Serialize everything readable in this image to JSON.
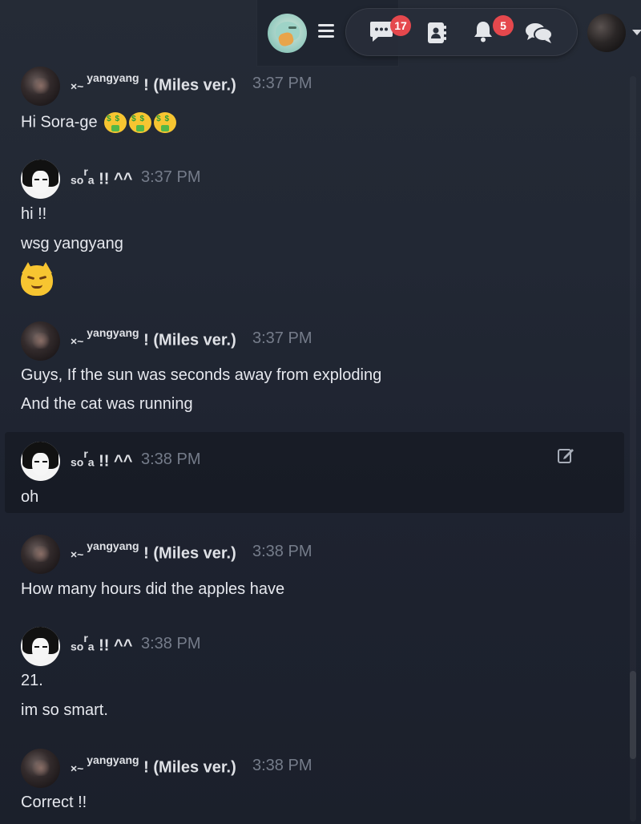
{
  "topbar": {
    "logo_icon": "app-logo",
    "menu_icon": "hamburger-menu-icon",
    "nav": [
      {
        "icon": "chat-bubble-icon",
        "badge": "17"
      },
      {
        "icon": "contacts-book-icon",
        "badge": ""
      },
      {
        "icon": "bell-icon",
        "badge": "5"
      },
      {
        "icon": "conversations-icon",
        "badge": ""
      }
    ],
    "badge_color": "#e5484d",
    "profile_caret_icon": "caret-down-icon"
  },
  "users": {
    "yangyang": {
      "prefix": "×~ ",
      "sup": "yangyang",
      "suffix": " ! (Miles ver.)"
    },
    "sora": {
      "prefix": "so",
      "sup": "r",
      "suffix_small": "a",
      "suffix": " !! ^^"
    }
  },
  "messages": [
    {
      "author": "yangyang",
      "time": "3:37 PM",
      "lines": [
        "Hi Sora-ge"
      ],
      "emoji": "money-mouth-face x3"
    },
    {
      "author": "sora",
      "time": "3:37 PM",
      "lines": [
        "hi !!",
        "wsg yangyang"
      ],
      "emoji": "smirking-cat-face"
    },
    {
      "author": "yangyang",
      "time": "3:37 PM",
      "lines": [
        "Guys, If the sun was seconds away from exploding",
        "And the cat was running"
      ]
    },
    {
      "author": "sora",
      "time": "3:38 PM",
      "lines": [
        "oh"
      ],
      "highlighted": true
    },
    {
      "author": "yangyang",
      "time": "3:38 PM",
      "lines": [
        "How many hours did the apples have"
      ]
    },
    {
      "author": "sora",
      "time": "3:38 PM",
      "lines": [
        "21.",
        "im so smart."
      ]
    },
    {
      "author": "yangyang",
      "time": "3:38 PM",
      "lines": [
        "Correct !!"
      ]
    }
  ],
  "colors": {
    "accent_badge": "#e5484d",
    "timestamp": "#757c8a",
    "text": "#e6e8ee"
  }
}
